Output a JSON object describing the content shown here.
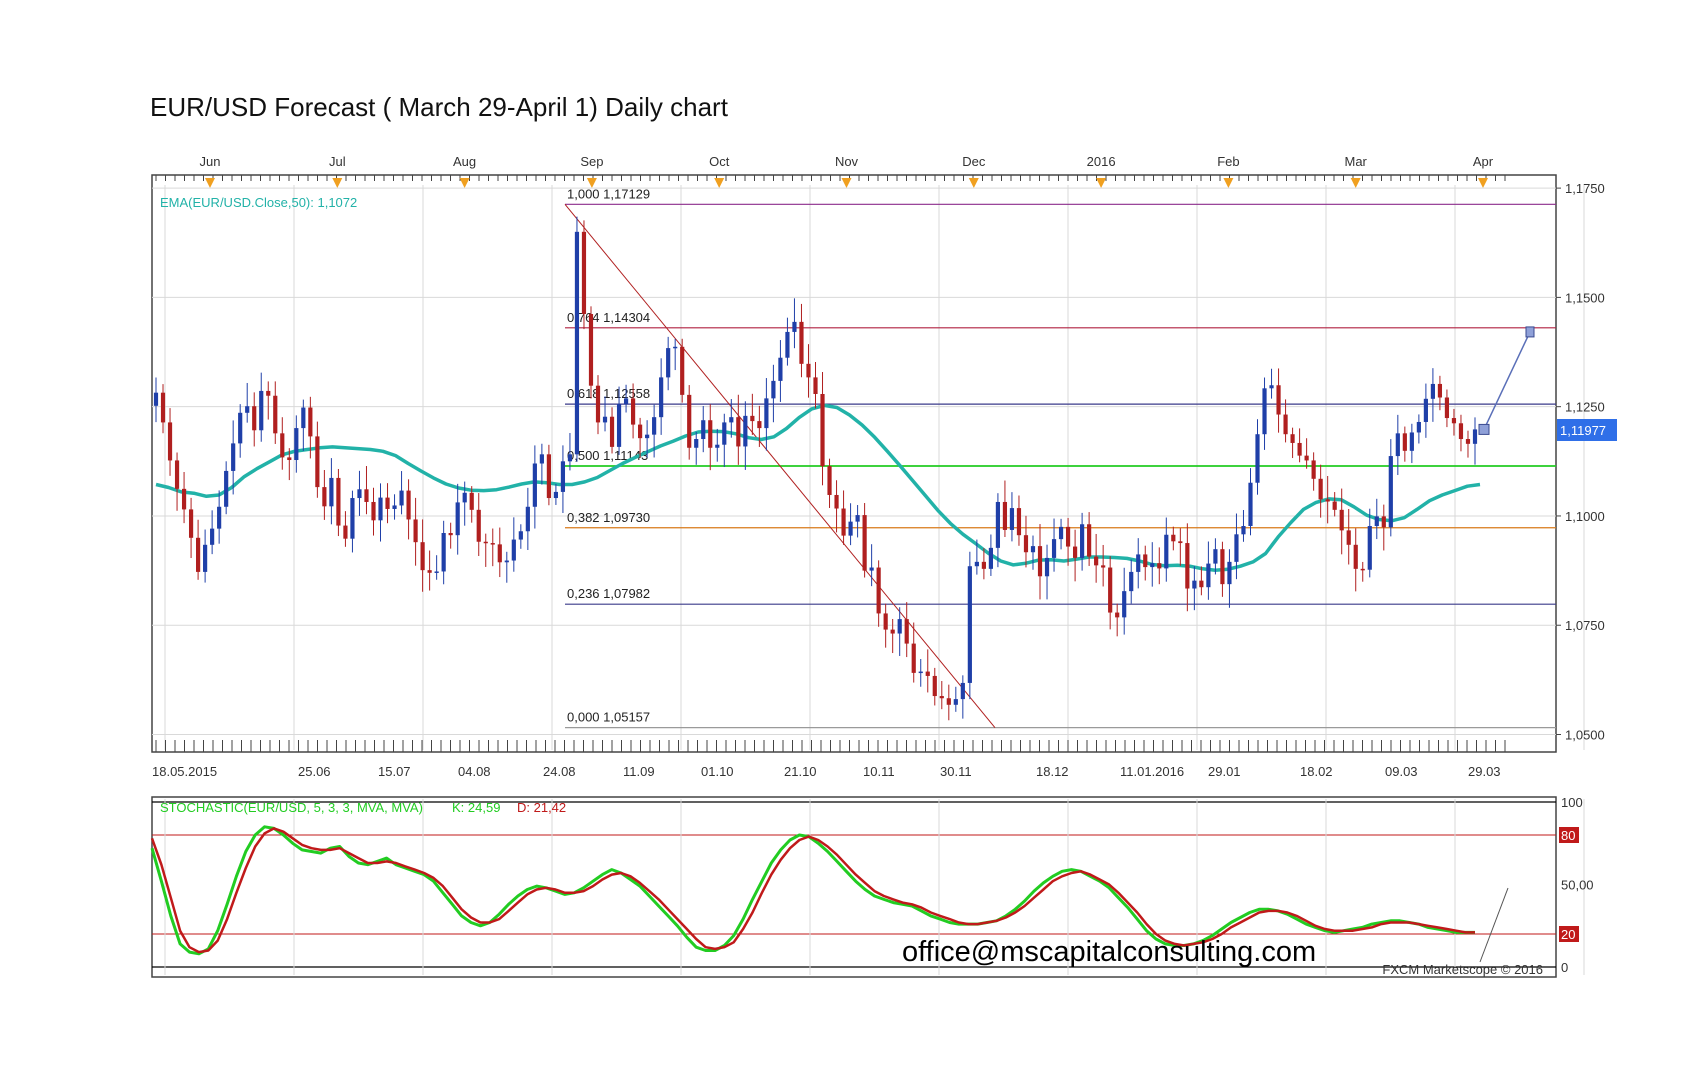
{
  "page": {
    "title": "EUR/USD Forecast ( March 29-April 1) Daily chart"
  },
  "chart_data": [
    {
      "type": "candlestick",
      "instrument": "EUR/USD",
      "timeframe": "Daily",
      "top_axis_months": [
        "Jun",
        "Jul",
        "Aug",
        "Sep",
        "Oct",
        "Nov",
        "Dec",
        "2016",
        "Feb",
        "Mar",
        "Apr"
      ],
      "x_tick_labels": [
        "18.05.2015",
        "25.06",
        "15.07",
        "04.08",
        "24.08",
        "11.09",
        "01.10",
        "21.10",
        "10.11",
        "30.11",
        "18.12",
        "11.01.2016",
        "29.01",
        "18.02",
        "09.03",
        "29.03"
      ],
      "y_tick_labels": [
        "1,1750",
        "1,1500",
        "1,1250",
        "1,1000",
        "1,0750",
        "1,0500"
      ],
      "y_ticks": [
        1.175,
        1.15,
        1.125,
        1.1,
        1.075,
        1.05
      ],
      "ylim": [
        1.046,
        1.178
      ],
      "current_price": {
        "label": "1,11977",
        "value": 1.11977
      },
      "indicator_label": "EMA(EUR/USD.Close,50): 1,1072",
      "fibonacci": {
        "start": {
          "date": "24.08",
          "price": 1.17129
        },
        "end": {
          "date": "03.12",
          "price": 1.05157
        },
        "levels": [
          {
            "label": "1,000 1,17129",
            "price": 1.17129,
            "color": "#8b2c8b"
          },
          {
            "label": "0,764 1,14304",
            "price": 1.14304,
            "color": "#b02040"
          },
          {
            "label": "0,618 1,12558",
            "price": 1.12558,
            "color": "#3a3a8a"
          },
          {
            "label": "0,500 1,11143",
            "price": 1.11143,
            "color": "#22cc22"
          },
          {
            "label": "0,382 1,09730",
            "price": 1.0973,
            "color": "#d87a1a"
          },
          {
            "label": "0,236 1,07982",
            "price": 1.07982,
            "color": "#3a3a8a"
          },
          {
            "label": "0,000 1,05157",
            "price": 1.05157,
            "color": "#9a9a9a"
          }
        ]
      },
      "close_path": [
        1.1282,
        1.1214,
        1.1127,
        1.1062,
        1.1015,
        1.095,
        1.0872,
        1.0934,
        1.0971,
        1.1021,
        1.1103,
        1.1166,
        1.1236,
        1.1251,
        1.1196,
        1.1286,
        1.1275,
        1.1189,
        1.1134,
        1.1128,
        1.1201,
        1.1248,
        1.1182,
        1.1066,
        1.1022,
        1.1087,
        1.0978,
        1.0948,
        1.1041,
        1.1061,
        1.1032,
        1.099,
        1.1042,
        1.1016,
        1.1024,
        1.1058,
        1.0992,
        1.094,
        1.0876,
        1.087,
        1.0873,
        1.0961,
        1.0956,
        1.1031,
        1.1053,
        1.1014,
        1.0941,
        1.0938,
        1.0935,
        1.0894,
        1.0898,
        1.0946,
        1.0965,
        1.1021,
        1.112,
        1.1141,
        1.1041,
        1.1055,
        1.1125,
        1.1141,
        1.165,
        1.1462,
        1.1298,
        1.1214,
        1.1227,
        1.1158,
        1.1256,
        1.1269,
        1.1209,
        1.1178,
        1.1186,
        1.1226,
        1.1317,
        1.1384,
        1.1387,
        1.1277,
        1.1156,
        1.1176,
        1.1219,
        1.1156,
        1.1163,
        1.1214,
        1.1226,
        1.1159,
        1.1229,
        1.1217,
        1.1201,
        1.1269,
        1.1309,
        1.1362,
        1.1421,
        1.1444,
        1.1348,
        1.1317,
        1.1279,
        1.1114,
        1.1048,
        1.1017,
        1.0955,
        1.0987,
        1.1002,
        1.0875,
        1.0882,
        1.0777,
        1.074,
        1.0731,
        1.0764,
        1.0708,
        1.0641,
        1.0644,
        1.0634,
        1.0588,
        1.0583,
        1.0568,
        1.0581,
        1.0618,
        1.0885,
        1.0895,
        1.0879,
        1.0927,
        1.1032,
        1.0968,
        1.1018,
        1.0956,
        1.0917,
        1.0931,
        1.0862,
        1.0904,
        1.0947,
        1.0975,
        1.093,
        1.0904,
        1.0981,
        1.0907,
        1.0887,
        1.0882,
        1.0779,
        1.0768,
        1.0828,
        1.0872,
        1.0912,
        1.0883,
        1.0892,
        1.088,
        1.0957,
        1.0942,
        1.0938,
        1.0834,
        1.0852,
        1.0837,
        1.0891,
        1.0924,
        1.0844,
        1.0895,
        1.0958,
        1.0977,
        1.1076,
        1.1187,
        1.1292,
        1.1299,
        1.1232,
        1.1187,
        1.1167,
        1.1138,
        1.1127,
        1.1085,
        1.1038,
        1.1033,
        1.1014,
        1.0967,
        1.0934,
        1.0879,
        1.0877,
        1.0977,
        1.0999,
        1.0974,
        1.1137,
        1.1189,
        1.1149,
        1.1191,
        1.1215,
        1.1268,
        1.1302,
        1.1271,
        1.1224,
        1.1212,
        1.1176,
        1.1165,
        1.1198
      ],
      "ema_path": [
        1.1072,
        1.1065,
        1.1055,
        1.1052,
        1.1045,
        1.1048,
        1.1065,
        1.109,
        1.1108,
        1.1124,
        1.114,
        1.1148,
        1.1152,
        1.1156,
        1.1158,
        1.1156,
        1.1154,
        1.1152,
        1.1148,
        1.1138,
        1.112,
        1.1103,
        1.1087,
        1.1073,
        1.1064,
        1.1059,
        1.1058,
        1.106,
        1.1066,
        1.1073,
        1.1078,
        1.1076,
        1.1072,
        1.1072,
        1.1078,
        1.1088,
        1.1104,
        1.112,
        1.1134,
        1.1147,
        1.116,
        1.1171,
        1.1183,
        1.1192,
        1.1194,
        1.1193,
        1.1188,
        1.1179,
        1.1175,
        1.1181,
        1.12,
        1.1225,
        1.1245,
        1.1253,
        1.1248,
        1.1231,
        1.1208,
        1.118,
        1.1148,
        1.1115,
        1.1081,
        1.1047,
        1.1013,
        1.0983,
        1.0958,
        1.0937,
        1.0915,
        1.0897,
        1.0888,
        1.0892,
        1.0899,
        1.09,
        1.0897,
        1.0901,
        1.0906,
        1.0906,
        1.0905,
        1.0903,
        1.0897,
        1.0889,
        1.0886,
        1.0887,
        1.0885,
        1.0879,
        1.0876,
        1.0878,
        1.0885,
        1.0895,
        1.0914,
        1.0952,
        1.0985,
        1.1015,
        1.1031,
        1.1039,
        1.1037,
        1.1021,
        1.1002,
        1.0992,
        1.0989,
        1.0996,
        1.1015,
        1.1035,
        1.1048,
        1.1058,
        1.1068,
        1.1072
      ],
      "forecast_arrow": [
        1.1198,
        1.1421
      ],
      "watermark": "office@mscapitalconsulting.com",
      "copyright": "FXCM Marketscope © 2016"
    },
    {
      "type": "line",
      "indicator_label": "STOCHASTIC(EUR/USD, 5, 3, 3, MVA, MVA)",
      "k_label": "K: 24,59",
      "d_label": "D: 21,42",
      "y_tick_labels": [
        "100",
        "80",
        "50,00",
        "20",
        "0"
      ],
      "y_ticks": [
        100,
        80,
        50,
        20,
        0
      ],
      "levels": [
        80,
        20
      ],
      "ylim": [
        0,
        100
      ],
      "k_path": [
        72,
        52,
        31,
        14,
        9,
        8,
        11,
        22,
        38,
        55,
        70,
        80,
        85,
        84,
        80,
        75,
        71,
        70,
        69,
        72,
        73,
        67,
        63,
        62,
        64,
        66,
        62,
        60,
        58,
        56,
        52,
        45,
        38,
        31,
        27,
        25,
        27,
        32,
        38,
        43,
        47,
        49,
        48,
        46,
        44,
        45,
        48,
        52,
        56,
        59,
        57,
        53,
        49,
        43,
        37,
        31,
        25,
        18,
        12,
        10,
        10,
        13,
        19,
        29,
        41,
        52,
        63,
        71,
        77,
        80,
        79,
        75,
        70,
        64,
        58,
        52,
        47,
        43,
        41,
        39,
        38,
        37,
        34,
        31,
        29,
        27,
        26,
        26,
        26,
        27,
        28,
        31,
        35,
        40,
        46,
        51,
        55,
        58,
        59,
        58,
        55,
        52,
        48,
        42,
        36,
        29,
        22,
        17,
        14,
        13,
        13,
        14,
        16,
        19,
        23,
        27,
        30,
        33,
        35,
        35,
        34,
        32,
        29,
        26,
        24,
        22,
        21,
        22,
        23,
        24,
        26,
        27,
        28,
        28,
        27,
        26,
        24,
        23,
        22,
        21,
        21,
        21
      ],
      "d_path": [
        78,
        62,
        42,
        22,
        12,
        9,
        10,
        16,
        29,
        45,
        60,
        73,
        81,
        84,
        82,
        78,
        74,
        72,
        71,
        71,
        72,
        69,
        66,
        63,
        63,
        64,
        63,
        61,
        59,
        57,
        54,
        49,
        42,
        35,
        30,
        27,
        27,
        29,
        34,
        39,
        44,
        47,
        48,
        47,
        45,
        45,
        46,
        49,
        53,
        56,
        57,
        55,
        51,
        46,
        41,
        35,
        29,
        23,
        17,
        12,
        11,
        12,
        15,
        23,
        33,
        45,
        56,
        65,
        72,
        77,
        79,
        77,
        73,
        68,
        62,
        56,
        51,
        46,
        43,
        41,
        39,
        38,
        36,
        33,
        31,
        29,
        27,
        26,
        26,
        27,
        28,
        30,
        33,
        37,
        42,
        47,
        52,
        55,
        57,
        58,
        56,
        53,
        50,
        45,
        39,
        33,
        26,
        20,
        16,
        14,
        13,
        14,
        15,
        17,
        20,
        24,
        27,
        30,
        33,
        34,
        34,
        33,
        31,
        28,
        25,
        23,
        22,
        22,
        22,
        23,
        24,
        26,
        27,
        27,
        27,
        26,
        25,
        24,
        23,
        22,
        21,
        21
      ]
    }
  ],
  "colors": {
    "candle_up": "#1f3fa8",
    "candle_down": "#b01f1f",
    "ema": "#22b2a8",
    "stoch_k": "#22cc22",
    "stoch_d": "#c01a1a",
    "price_box": "#2f6fe8",
    "grid": "#d9d9d9",
    "forecast": "#5a6fb8"
  }
}
